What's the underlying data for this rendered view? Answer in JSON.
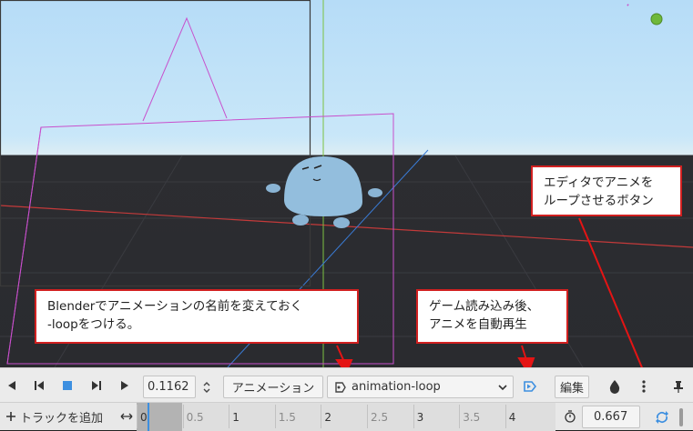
{
  "toolbar": {
    "time_value": "0.1162",
    "animation_menu_label": "アニメーション",
    "selected_animation": "animation-loop",
    "edit_label": "編集"
  },
  "timeline": {
    "add_track_label": "トラックを追加",
    "ruler_labels": [
      "0",
      "0.5",
      "1",
      "1.5",
      "2",
      "2.5",
      "3",
      "3.5",
      "4"
    ],
    "length_value": "0.667"
  },
  "annotations": {
    "loop_button_note": "エディタでアニメを\nループさせるボタン",
    "rename_note": "Blenderでアニメーションの名前を変えておく\n-loopをつける。",
    "autoplay_note": "ゲーム読み込み後、\nアニメを自動再生"
  },
  "colors": {
    "accent": "#3d8fe0",
    "callout_border": "#d12020",
    "arrow": "#e41414"
  },
  "icons": {
    "play_back": "play-backwards-icon",
    "play_back_from_end": "play-backwards-from-end-icon",
    "stop": "stop-icon",
    "play_from_start": "play-from-start-icon",
    "play": "play-icon",
    "autoplay": "autoplay-icon",
    "onion": "onion-skin-icon",
    "pin": "pin-icon",
    "loop": "loop-icon",
    "timer": "timer-icon"
  }
}
